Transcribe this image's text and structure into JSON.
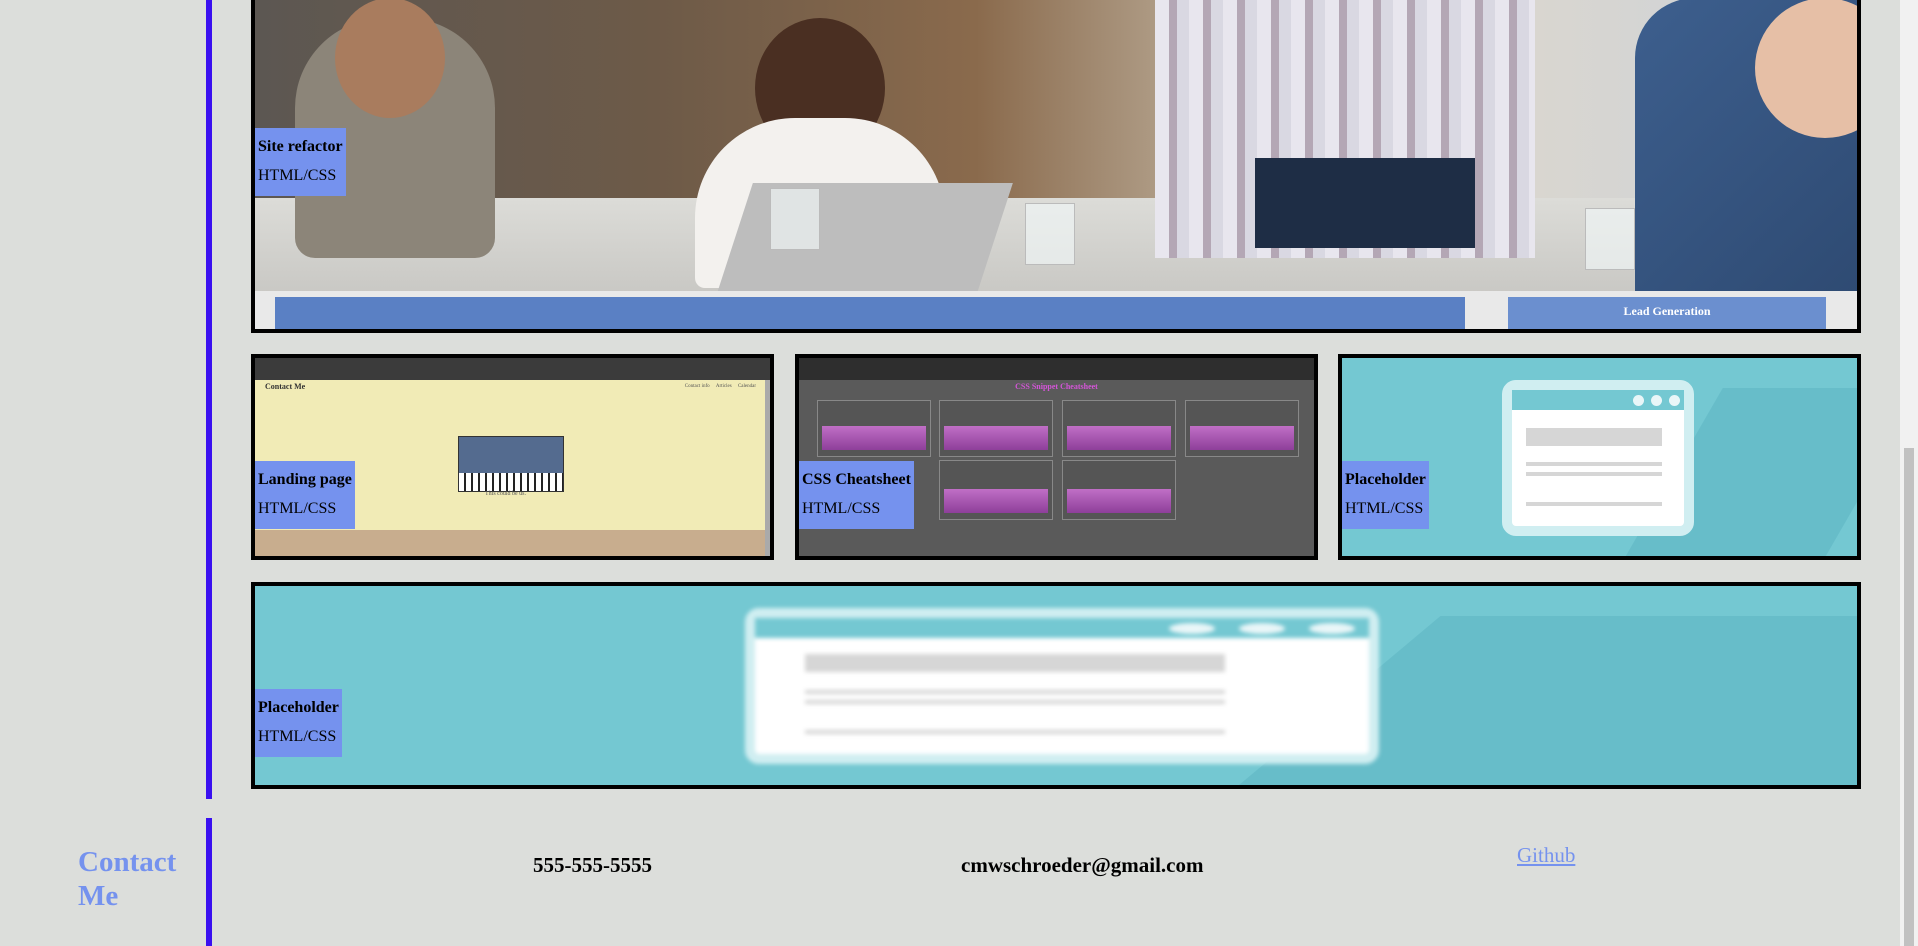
{
  "projects": [
    {
      "title": "Site refactor",
      "subtitle": "HTML/CSS",
      "preview_text": [
        "Lead Generation"
      ]
    },
    {
      "title": "Landing page",
      "subtitle": "HTML/CSS",
      "preview_text": [
        "Contact Me",
        "Contact info",
        "Articles",
        "Calendar",
        "This could be us."
      ]
    },
    {
      "title": "CSS Cheatsheet",
      "subtitle": "HTML/CSS",
      "preview_text": [
        "CSS Snippet Cheatsheet"
      ]
    },
    {
      "title": "Placeholder",
      "subtitle": "HTML/CSS"
    },
    {
      "title": "Placeholder",
      "subtitle": "HTML/CSS"
    }
  ],
  "contact": {
    "title": [
      "Contact",
      "Me"
    ],
    "phone": "555-555-5555",
    "email": "cmwschroeder@gmail.com",
    "github": "Github"
  },
  "colors": {
    "accent": "#7592ee",
    "divider": "#3a10f0",
    "background": "#dcdedb",
    "placeholder_bg": "#74c8d2"
  }
}
